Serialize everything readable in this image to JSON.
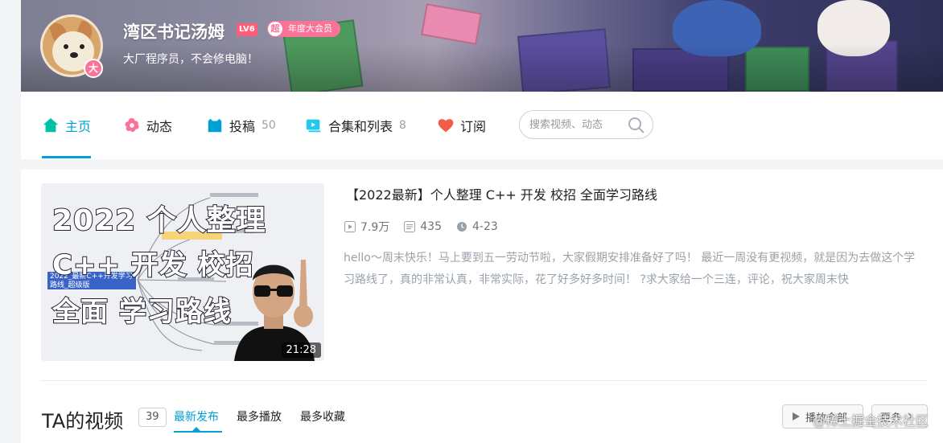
{
  "header": {
    "username": "湾区书记汤姆",
    "level": "LV6",
    "vip_icon": "超",
    "vip_label": "年度大会员",
    "vip_badge_char": "大",
    "signature": "大厂程序员，不会修电脑！"
  },
  "nav": {
    "items": [
      {
        "label": "主页",
        "icon": "home-icon",
        "count": ""
      },
      {
        "label": "动态",
        "icon": "dynamic-icon",
        "count": ""
      },
      {
        "label": "投稿",
        "icon": "upload-icon",
        "count": "50"
      },
      {
        "label": "合集和列表",
        "icon": "collection-icon",
        "count": "8"
      },
      {
        "label": "订阅",
        "icon": "heart-icon",
        "count": ""
      }
    ],
    "search_placeholder": "搜索视频、动态"
  },
  "featured": {
    "thumb_line1": "2022 个人整理",
    "thumb_line2": "C++ 开发 校招",
    "thumb_line3": "全面 学习路线",
    "thumb_box": "2022_最新C++开发学习路线_超级版",
    "duration": "21:28",
    "title": "【2022最新】个人整理 C++ 开发 校招 全面学习路线",
    "views": "7.9万",
    "danmaku": "435",
    "date": "4-23",
    "description": "hello～周末快乐！马上要到五一劳动节啦，大家假期安排准备好了吗！ 最近一周没有更视频，就是因为去做这个学习路线了，真的非常认真，非常实际，花了好多好多时间！ ?求大家给一个三连，评论，祝大家周末快"
  },
  "videos_section": {
    "title": "TA的视频",
    "count": "39",
    "tabs": [
      "最新发布",
      "最多播放",
      "最多收藏"
    ],
    "play_all": "播放全部",
    "more": "更多"
  },
  "watermark": "@稀土掘金技术社区",
  "colors": {
    "accent": "#00a1d6",
    "pink": "#fb7299"
  }
}
